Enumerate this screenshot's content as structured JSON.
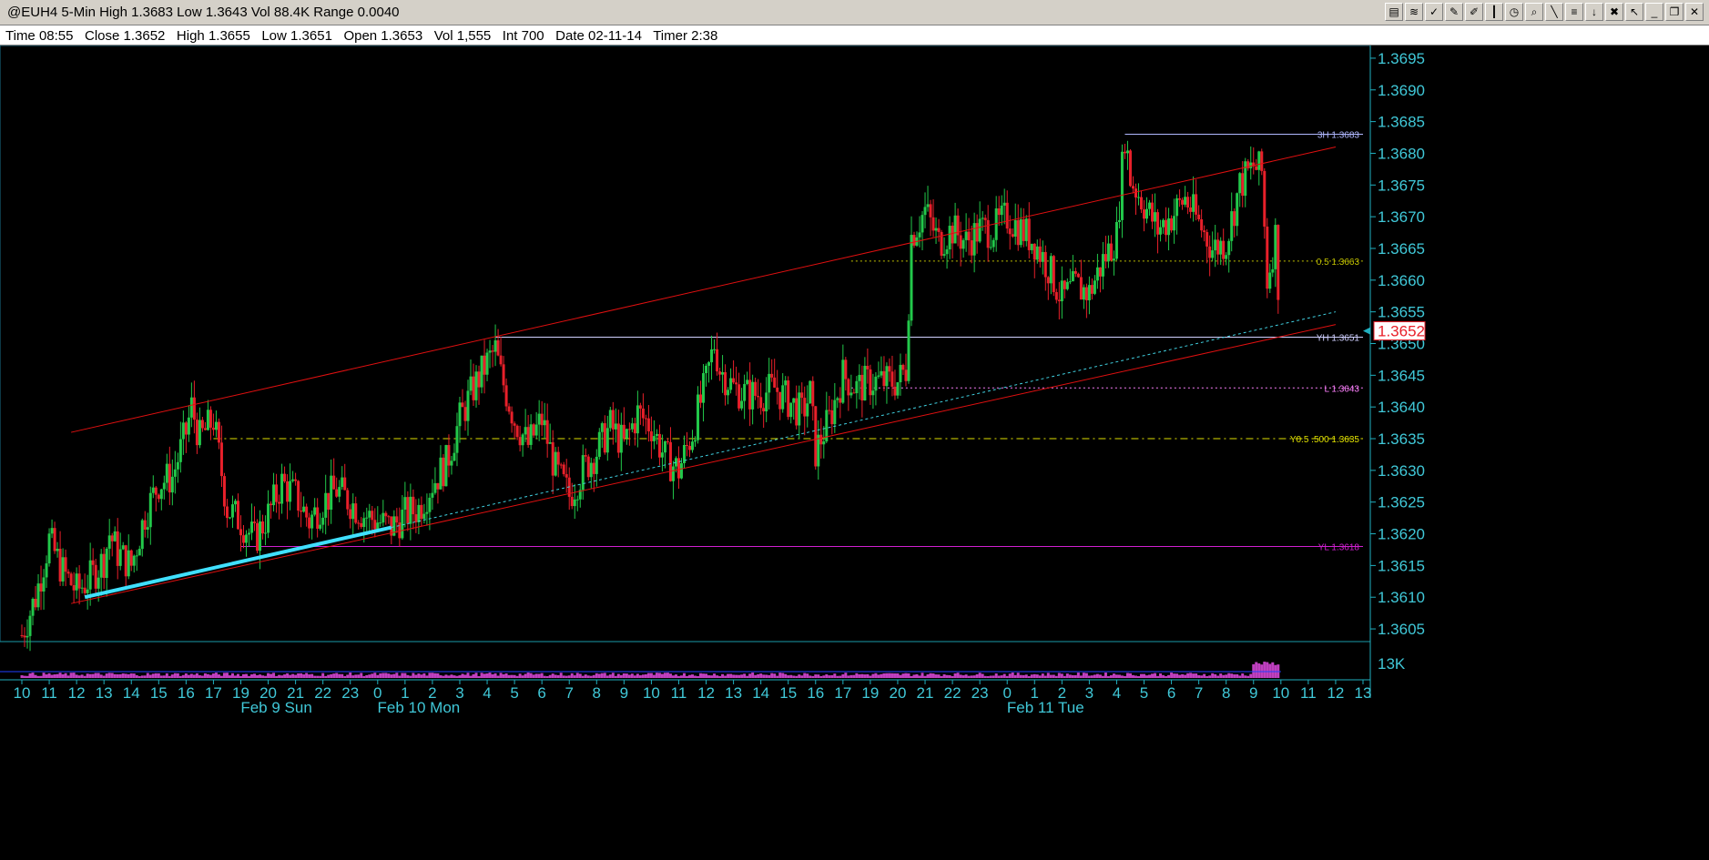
{
  "window": {
    "title": "@EUH4 5-Min High 1.3683 Low 1.3643 Vol 88.4K Range 0.0040",
    "toolbar_icons": [
      "chart-icon",
      "compare-icon",
      "indicator-icon",
      "draw-icon",
      "pen-icon",
      "bar-icon",
      "clock-icon",
      "zoom-icon",
      "line-icon",
      "fib-icon",
      "arrow-icon",
      "delete-icon",
      "cursor-icon",
      "minimize-icon",
      "restore-icon",
      "close-icon"
    ]
  },
  "info": {
    "time": "Time 08:55",
    "close": "Close 1.3652",
    "high": "High 1.3655",
    "low": "Low 1.3651",
    "open": "Open 1.3653",
    "vol": "Vol 1,555",
    "int": "Int 700",
    "date": "Date 02-11-14",
    "timer": "Timer 2:38"
  },
  "chart_data": {
    "type": "candlestick",
    "symbol": "@EUH4",
    "interval": "5-Min",
    "y_ticks": [
      "1.3605",
      "1.3610",
      "1.3615",
      "1.3620",
      "1.3625",
      "1.3630",
      "1.3635",
      "1.3640",
      "1.3645",
      "1.3650",
      "1.3655",
      "1.3660",
      "1.3665",
      "1.3670",
      "1.3675",
      "1.3680",
      "1.3685",
      "1.3690",
      "1.3695"
    ],
    "ylim": [
      1.3603,
      1.3697
    ],
    "x_hour_labels": [
      "10",
      "11",
      "12",
      "13",
      "14",
      "15",
      "16",
      "17",
      "19",
      "20",
      "21",
      "22",
      "23",
      "0",
      "1",
      "2",
      "3",
      "4",
      "5",
      "6",
      "7",
      "8",
      "9",
      "10",
      "11",
      "12",
      "13",
      "14",
      "15",
      "16",
      "17",
      "19",
      "20",
      "21",
      "22",
      "23",
      "0",
      "1",
      "2",
      "3",
      "4",
      "5",
      "6",
      "7",
      "8",
      "9",
      "10",
      "11",
      "12",
      "13"
    ],
    "day_labels": [
      "Feb 9 Sun",
      "Feb 10 Mon",
      "Feb 11 Tue"
    ],
    "price_path": [
      [
        0,
        1.3604
      ],
      [
        0.5,
        1.361
      ],
      [
        1.0,
        1.3619
      ],
      [
        1.5,
        1.3614
      ],
      [
        2.0,
        1.3611
      ],
      [
        2.5,
        1.3613
      ],
      [
        3.0,
        1.3616
      ],
      [
        3.2,
        1.362
      ],
      [
        3.5,
        1.3617
      ],
      [
        4.0,
        1.3615
      ],
      [
        4.5,
        1.3623
      ],
      [
        5.0,
        1.3628
      ],
      [
        5.5,
        1.3629
      ],
      [
        6.0,
        1.3636
      ],
      [
        6.2,
        1.364
      ],
      [
        6.5,
        1.3635
      ],
      [
        7.0,
        1.3638
      ],
      [
        7.5,
        1.3624
      ],
      [
        8.0,
        1.3622
      ],
      [
        8.5,
        1.3619
      ],
      [
        9.0,
        1.3623
      ],
      [
        9.5,
        1.3628
      ],
      [
        10.0,
        1.3626
      ],
      [
        10.5,
        1.3622
      ],
      [
        11.0,
        1.3625
      ],
      [
        11.5,
        1.3627
      ],
      [
        12.0,
        1.3625
      ],
      [
        12.5,
        1.3623
      ],
      [
        13.0,
        1.3622
      ],
      [
        13.5,
        1.3621
      ],
      [
        14.0,
        1.3623
      ],
      [
        14.5,
        1.3624
      ],
      [
        15.0,
        1.3628
      ],
      [
        15.5,
        1.3631
      ],
      [
        16.0,
        1.3638
      ],
      [
        16.5,
        1.3643
      ],
      [
        17.0,
        1.3647
      ],
      [
        17.3,
        1.3649
      ],
      [
        17.5,
        1.3645
      ],
      [
        18.0,
        1.3638
      ],
      [
        18.5,
        1.3634
      ],
      [
        19.0,
        1.3638
      ],
      [
        19.5,
        1.363
      ],
      [
        20.0,
        1.3626
      ],
      [
        20.5,
        1.363
      ],
      [
        21.0,
        1.3633
      ],
      [
        21.5,
        1.3637
      ],
      [
        22.0,
        1.3634
      ],
      [
        22.5,
        1.3639
      ],
      [
        23.0,
        1.3637
      ],
      [
        23.5,
        1.3632
      ],
      [
        24.0,
        1.363
      ],
      [
        24.5,
        1.3636
      ],
      [
        25.0,
        1.3644
      ],
      [
        25.3,
        1.365
      ],
      [
        25.5,
        1.3646
      ],
      [
        26.0,
        1.3643
      ],
      [
        26.5,
        1.3642
      ],
      [
        27.0,
        1.3642
      ],
      [
        27.5,
        1.3643
      ],
      [
        28.0,
        1.3641
      ],
      [
        28.5,
        1.3639
      ],
      [
        28.8,
        1.3642
      ],
      [
        29.0,
        1.3633
      ],
      [
        29.5,
        1.3638
      ],
      [
        30.0,
        1.3645
      ],
      [
        30.5,
        1.3643
      ],
      [
        31.0,
        1.3644
      ],
      [
        31.5,
        1.3644
      ],
      [
        32.0,
        1.3644
      ],
      [
        32.3,
        1.3646
      ],
      [
        32.5,
        1.3667
      ],
      [
        33.0,
        1.3671
      ],
      [
        33.5,
        1.3666
      ],
      [
        34.0,
        1.3668
      ],
      [
        34.5,
        1.3666
      ],
      [
        35.0,
        1.3668
      ],
      [
        35.5,
        1.3668
      ],
      [
        36.0,
        1.367
      ],
      [
        36.5,
        1.3668
      ],
      [
        37.0,
        1.3666
      ],
      [
        37.5,
        1.3662
      ],
      [
        38.0,
        1.3657
      ],
      [
        38.5,
        1.3659
      ],
      [
        39.0,
        1.3658
      ],
      [
        39.5,
        1.3663
      ],
      [
        40.0,
        1.3667
      ],
      [
        40.3,
        1.3683
      ],
      [
        40.5,
        1.3676
      ],
      [
        41.0,
        1.3672
      ],
      [
        41.5,
        1.3668
      ],
      [
        42.0,
        1.367
      ],
      [
        42.5,
        1.3673
      ],
      [
        43.0,
        1.3669
      ],
      [
        43.5,
        1.3665
      ],
      [
        44.0,
        1.3666
      ],
      [
        44.5,
        1.3675
      ],
      [
        45.0,
        1.3678
      ],
      [
        45.3,
        1.3677
      ],
      [
        45.5,
        1.366
      ],
      [
        45.8,
        1.3667
      ],
      [
        46.0,
        1.3652
      ]
    ],
    "horizontal_levels": [
      {
        "label": "3H 1.3683",
        "price": 1.3683,
        "x_from": 40.3,
        "color": "#b0b8ff",
        "dash": "solid"
      },
      {
        "label": "0.5 1.3663",
        "price": 1.3663,
        "x_from": 30.3,
        "color": "#c0c000",
        "dash": "2,3"
      },
      {
        "label": "YH 1.3651",
        "price": 1.3651,
        "x_from": 17.3,
        "color": "#d0d0ff",
        "dash": "solid"
      },
      {
        "label": "L 1.3643",
        "price": 1.3643,
        "x_from": 30.3,
        "color": "#ff80ff",
        "dash": "2,3"
      },
      {
        "label": "Y0.5 .500 1.3635",
        "price": 1.3635,
        "x_from": 7.0,
        "color": "#e0e000",
        "dash": "8,4,2,4"
      },
      {
        "label": "YL 1.3618",
        "price": 1.3618,
        "x_from": 8.0,
        "color": "#d020d0",
        "dash": "solid"
      }
    ],
    "trendlines": [
      {
        "name": "upper-channel",
        "from": [
          1.8,
          1.3636
        ],
        "to": [
          48.0,
          1.3681
        ],
        "color": "#e01010",
        "width": 1
      },
      {
        "name": "lower-channel",
        "from": [
          1.8,
          1.3609
        ],
        "to": [
          48.0,
          1.3653
        ],
        "color": "#e01010",
        "width": 1
      },
      {
        "name": "support-dotted",
        "from": [
          13.5,
          1.3621
        ],
        "to": [
          48.0,
          1.3655
        ],
        "color": "#40d0e0",
        "width": 1,
        "dash": "3,3"
      },
      {
        "name": "support-thick",
        "from": [
          2.3,
          1.361
        ],
        "to": [
          13.5,
          1.3621
        ],
        "color": "#40e0ff",
        "width": 4
      }
    ],
    "last_price": "1.3652",
    "volume_label": "13K"
  }
}
